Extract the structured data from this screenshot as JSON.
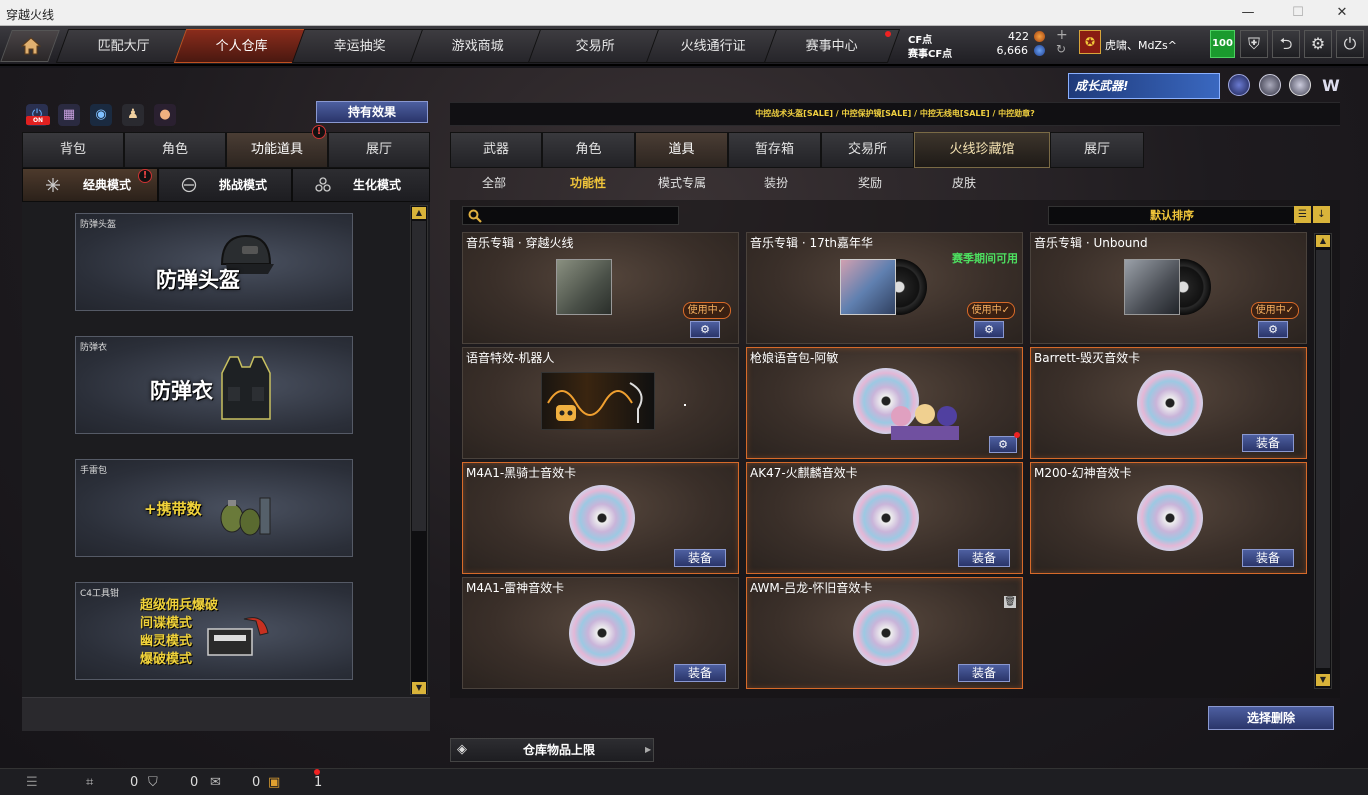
{
  "window": {
    "title": "穿越火线",
    "minimize": "—",
    "maximize": "☐",
    "close": "✕"
  },
  "topnav": {
    "tabs": [
      "匹配大厅",
      "个人仓库",
      "幸运抽奖",
      "游戏商城",
      "交易所",
      "火线通行证",
      "赛事中心"
    ],
    "active_tab": "个人仓库",
    "cf_label": "CF点",
    "cf_value": "422",
    "match_cf_label": "赛事CF点",
    "match_cf_value": "6,666",
    "username": "虎啸、MdZs^",
    "level": "100"
  },
  "banner": {
    "promo": "成长武器!",
    "ticker": "中控战术头盔[SALE] / 中控保护镜[SALE] / 中控无线电[SALE] / 中控勋章?"
  },
  "left": {
    "effects_button": "持有效果",
    "tabs": [
      "背包",
      "角色",
      "功能道具",
      "展厅"
    ],
    "active_tab": "功能道具",
    "modes": [
      "经典模式",
      "挑战模式",
      "生化模式"
    ],
    "active_mode": "经典模式",
    "items": [
      {
        "name": "防弹头盔",
        "big": "防弹头盔"
      },
      {
        "name": "防弹衣",
        "big": "防弹衣"
      },
      {
        "name": "手雷包",
        "big": "+携带数"
      },
      {
        "name": "C4工具钳",
        "lines": [
          "超级佣兵爆破",
          "间谍模式",
          "幽灵模式",
          "爆破模式"
        ]
      }
    ]
  },
  "right": {
    "tabs": [
      "武器",
      "角色",
      "道具",
      "暂存箱",
      "交易所",
      "火线珍藏馆",
      "展厅"
    ],
    "active_tab": "道具",
    "subtabs": [
      "全部",
      "功能性",
      "模式专属",
      "装扮",
      "奖励",
      "皮肤"
    ],
    "active_subtab": "功能性",
    "sort_label": "默认排序",
    "search_placeholder": "",
    "cards": [
      {
        "name": "音乐专辑 · 穿越火线",
        "status": "使用中✓",
        "kind": "album"
      },
      {
        "name": "音乐专辑 · 17th嘉年华",
        "status": "使用中✓",
        "note": "赛季期间可用",
        "kind": "album"
      },
      {
        "name": "音乐专辑 · Unbound",
        "status": "使用中✓",
        "kind": "album"
      },
      {
        "name": "语音特效-机器人",
        "kind": "robot"
      },
      {
        "name": "枪娘语音包-阿敏",
        "kind": "girls"
      },
      {
        "name": "Barrett-毁灭音效卡",
        "button": "装备",
        "kind": "disc"
      },
      {
        "name": "M4A1-黑骑士音效卡",
        "button": "装备",
        "kind": "disc"
      },
      {
        "name": "AK47-火麒麟音效卡",
        "button": "装备",
        "kind": "disc"
      },
      {
        "name": "M200-幻神音效卡",
        "button": "装备",
        "kind": "disc"
      },
      {
        "name": "M4A1-雷神音效卡",
        "button": "装备",
        "kind": "disc"
      },
      {
        "name": "AWM-吕龙-怀旧音效卡",
        "button": "装备",
        "kind": "disc"
      }
    ],
    "delete_button": "选择删除",
    "store_limit": "仓库物品上限"
  },
  "bottombar": {
    "count1": "0",
    "count2": "0",
    "count3": "0",
    "count4": "1"
  },
  "colors": {
    "accent": "#f0c53a",
    "active_tab": "#8a2c1c",
    "button": "#2a356a",
    "border_orange": "#d66a2a"
  }
}
